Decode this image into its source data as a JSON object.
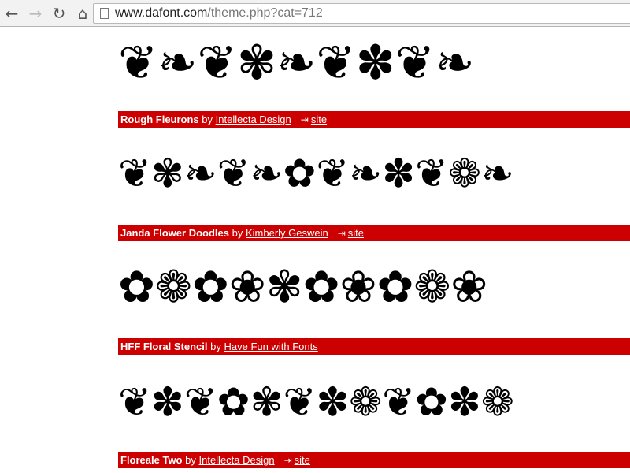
{
  "browser": {
    "url_host": "www.dafont.com",
    "url_path": "/theme.php?cat=712"
  },
  "fonts": [
    {
      "preview_glyphs": "❦❧❦✾❧❦✽❦❧",
      "preview_size": 60
    },
    {
      "name": "Rough Fleurons",
      "by": "by",
      "author": "Intellecta Design",
      "site": "site",
      "preview_glyphs": "❦✾❧❦❧✿❦❧✽❦❁❧",
      "preview_size": 50
    },
    {
      "name": "Janda Flower Doodles",
      "by": "by",
      "author": "Kimberly Geswein",
      "site": "site",
      "preview_glyphs": "✿❁✿❀✾✿❀✿❁❀",
      "preview_size": 56
    },
    {
      "name": "HFF Floral Stencil",
      "by": "by",
      "author": "Have Fun with Fonts",
      "preview_glyphs": "❦✽❦✿✾❦✽❁❦✿✽❁",
      "preview_size": 50
    },
    {
      "name": "Floreale Two",
      "by": "by",
      "author": "Intellecta Design",
      "site": "site"
    }
  ]
}
